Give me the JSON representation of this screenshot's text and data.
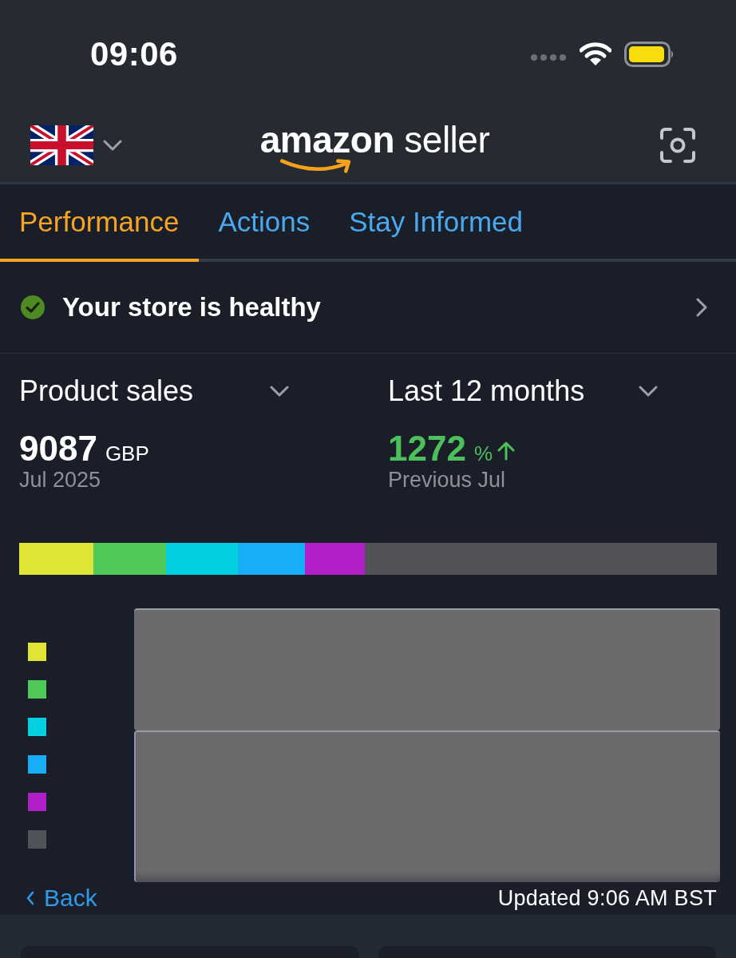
{
  "status_bar": {
    "time": "09:06"
  },
  "header": {
    "logo": "**amazon** seller"
  },
  "tabs": [
    {
      "label": "Performance",
      "selected": true
    },
    {
      "label": "Actions",
      "selected": false
    },
    {
      "label": "Stay Informed",
      "selected": false
    }
  ],
  "health": {
    "healthy": true,
    "message": "Your store is healthy"
  },
  "metrics": [
    {
      "selector": "Product sales",
      "value": "9087",
      "unit": "GBP",
      "caption": "Jul 2025",
      "rising": false
    },
    {
      "selector": "Last 12 months",
      "value": "1272",
      "unit": "%",
      "caption": "Previous Jul",
      "rising": true
    }
  ],
  "share_bar": [
    {
      "color": "#dee535"
    },
    {
      "color": "#4fc957"
    },
    {
      "color": "#00d0e0"
    },
    {
      "color": "#17aef5"
    },
    {
      "color": "#b11fc8"
    },
    {
      "color": "#525259"
    }
  ],
  "legend": [
    {
      "color": "#dee535"
    },
    {
      "color": "#4fc957"
    },
    {
      "color": "#00d0e0"
    },
    {
      "color": "#17aef5"
    },
    {
      "color": "#b11fc8"
    },
    {
      "color": "#525259"
    }
  ],
  "footer": {
    "back": "Back",
    "updated": "Updated 9:06 AM BST"
  }
}
